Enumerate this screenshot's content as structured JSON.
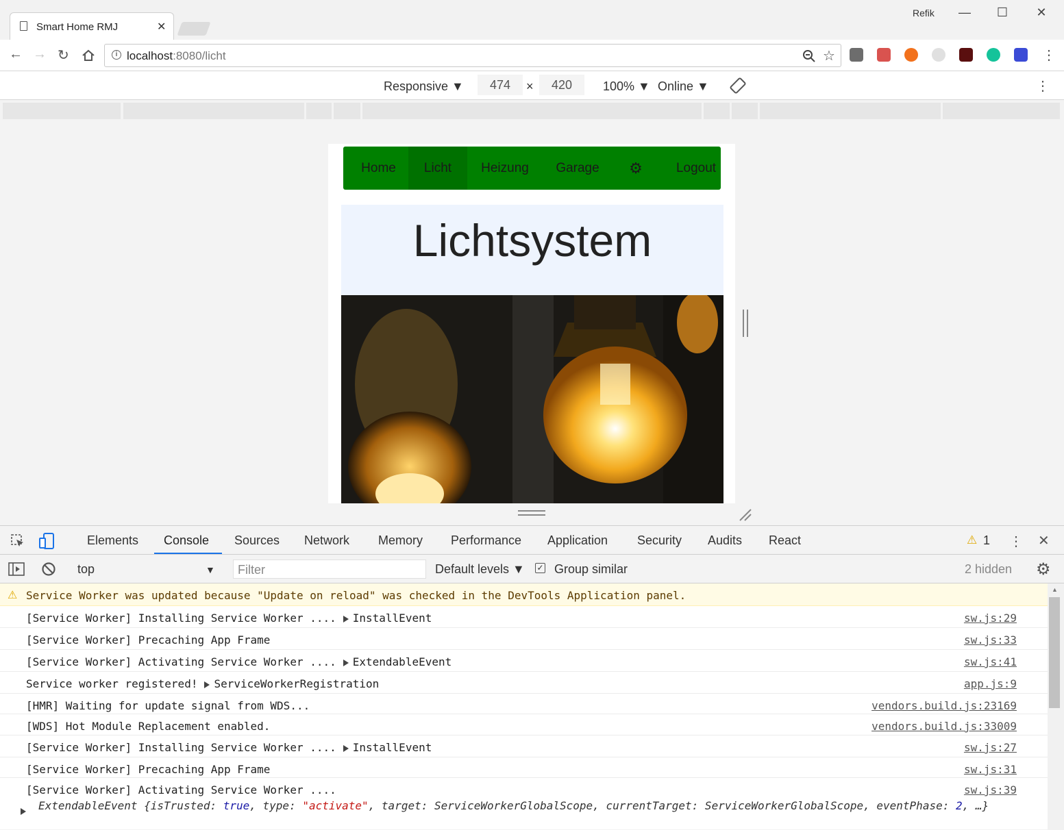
{
  "browser": {
    "tab_title": "Smart Home RMJ",
    "tab_close": "✕",
    "user_name": "Refik",
    "window_controls": [
      "—",
      "☐",
      "✕"
    ],
    "url_host": "localhost",
    "url_path": ":8080/licht"
  },
  "device_toolbar": {
    "device": "Responsive ▼",
    "width": "474",
    "times": "×",
    "height": "420",
    "zoom": "100% ▼",
    "network": "Online ▼"
  },
  "page": {
    "nav_items": [
      "Home",
      "Licht",
      "Heizung",
      "Garage",
      "Logout"
    ],
    "active_nav": "Licht",
    "heading": "Lichtsystem",
    "nav_color": "#008000"
  },
  "devtools": {
    "tabs": [
      "Elements",
      "Console",
      "Sources",
      "Network",
      "Memory",
      "Performance",
      "Application",
      "Security",
      "Audits",
      "React"
    ],
    "active_tab": "Console",
    "warning_count": "1",
    "context": "top",
    "filter_placeholder": "Filter",
    "levels": "Default levels ▼",
    "group_similar": "Group similar",
    "hidden": "2 hidden"
  },
  "console": {
    "warning": "Service Worker was updated because \"Update on reload\" was checked in the DevTools Application panel.",
    "rows": [
      {
        "msg": "[Service Worker] Installing Service Worker ....",
        "obj": "InstallEvent",
        "src": "sw.js:29"
      },
      {
        "msg": "[Service Worker] Precaching App Frame",
        "obj": "",
        "src": "sw.js:33"
      },
      {
        "msg": "[Service Worker] Activating Service Worker ....",
        "obj": "ExtendableEvent",
        "src": "sw.js:41"
      },
      {
        "msg": "Service worker registered!",
        "obj": "ServiceWorkerRegistration",
        "src": "app.js:9"
      },
      {
        "msg": "[HMR] Waiting for update signal from WDS...",
        "obj": "",
        "src": "vendors.build.js:23169"
      },
      {
        "msg": "[WDS] Hot Module Replacement enabled.",
        "obj": "",
        "src": "vendors.build.js:33009"
      },
      {
        "msg": "[Service Worker] Installing Service Worker ....",
        "obj": "InstallEvent",
        "src": "sw.js:27"
      },
      {
        "msg": "[Service Worker] Precaching App Frame",
        "obj": "",
        "src": "sw.js:31"
      },
      {
        "msg": "[Service Worker] Activating Service Worker ....",
        "obj": "",
        "src": "sw.js:39"
      }
    ],
    "expanded_event": {
      "name": "ExtendableEvent",
      "p1": "{isTrusted: ",
      "v1": "true",
      "p2": ", type: ",
      "v2": "\"activate\"",
      "p3": ", target: ServiceWorkerGlobalScope, currentTarget: ServiceWorkerGlobalScope, eventPhase:",
      "v3": "2",
      "p4": ", …}"
    }
  }
}
